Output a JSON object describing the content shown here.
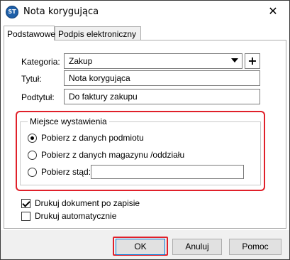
{
  "window": {
    "title": "Nota korygująca",
    "app_icon_text": "ST",
    "close_glyph": "✕"
  },
  "tabs": [
    {
      "label": "Podstawowe",
      "active": true
    },
    {
      "label": "Podpis elektroniczny",
      "active": false
    }
  ],
  "form": {
    "kategoria_label": "Kategoria:",
    "kategoria_value": "Zakup",
    "add_glyph": "+",
    "tytul_label": "Tytuł:",
    "tytul_value": "Nota korygująca",
    "podtytul_label": "Podtytuł:",
    "podtytul_value": "Do faktury zakupu"
  },
  "miejsce": {
    "legend": "Miejsce wystawienia",
    "options": [
      {
        "label": "Pobierz z danych podmiotu",
        "selected": true
      },
      {
        "label": "Pobierz z danych magazynu /oddziału",
        "selected": false
      },
      {
        "label": "Pobierz stąd:",
        "selected": false
      }
    ],
    "custom_value": ""
  },
  "checks": [
    {
      "label": "Drukuj dokument po zapisie",
      "checked": true
    },
    {
      "label": "Drukuj automatycznie",
      "checked": false
    }
  ],
  "buttons": {
    "ok": "OK",
    "cancel": "Anuluj",
    "help": "Pomoc"
  },
  "colors": {
    "highlight": "#e0202a",
    "footer_bg": "#f0f0f0",
    "default_button_border": "#0078d7"
  }
}
